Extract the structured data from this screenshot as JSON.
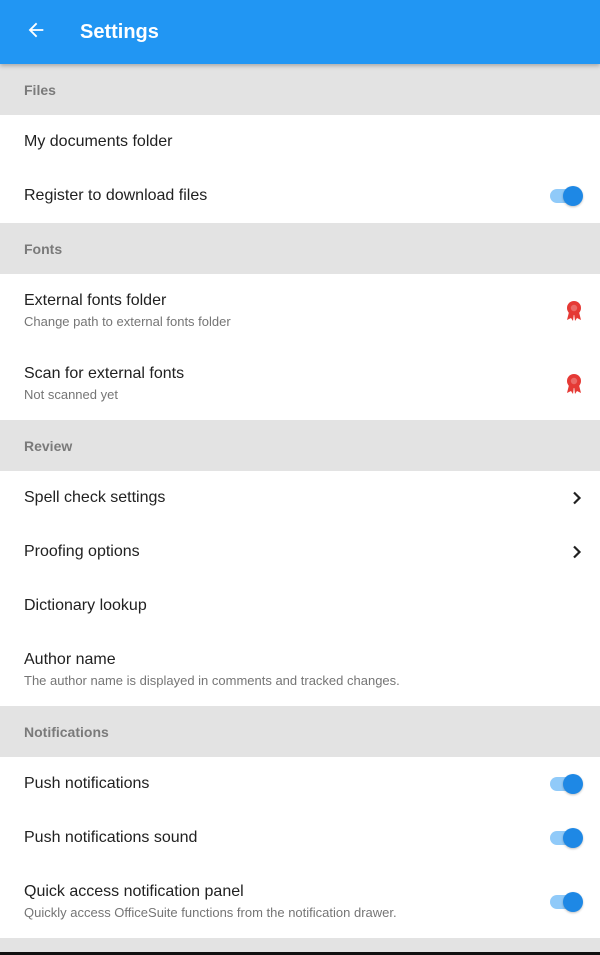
{
  "appbar": {
    "title": "Settings",
    "back_icon": "arrow-back-icon",
    "color": "#2196F3"
  },
  "sections": {
    "files": {
      "header": "Files",
      "my_documents": {
        "label": "My documents folder"
      },
      "register_download": {
        "label": "Register to download files",
        "toggle_on": true
      }
    },
    "fonts": {
      "header": "Fonts",
      "external_folder": {
        "label": "External fonts folder",
        "summary": "Change path to external fonts folder",
        "icon": "premium-badge-icon"
      },
      "scan_fonts": {
        "label": "Scan for external fonts",
        "summary": "Not scanned yet",
        "icon": "premium-badge-icon"
      }
    },
    "review": {
      "header": "Review",
      "spell_check": {
        "label": "Spell check settings",
        "icon": "chevron-right-icon"
      },
      "proofing": {
        "label": "Proofing options",
        "icon": "chevron-right-icon"
      },
      "dictionary": {
        "label": "Dictionary lookup"
      },
      "author": {
        "label": "Author name",
        "summary": "The author name is displayed in comments and tracked changes."
      }
    },
    "notifications": {
      "header": "Notifications",
      "push": {
        "label": "Push notifications",
        "toggle_on": true
      },
      "push_sound": {
        "label": "Push notifications sound",
        "toggle_on": true
      },
      "quick_access": {
        "label": "Quick access notification panel",
        "summary": "Quickly access OfficeSuite functions from the notification drawer.",
        "toggle_on": true
      }
    }
  },
  "colors": {
    "accent": "#1E88E5",
    "switch_track": "#90CAF9",
    "badge": "#E53935",
    "section_bg": "#E3E3E3"
  }
}
